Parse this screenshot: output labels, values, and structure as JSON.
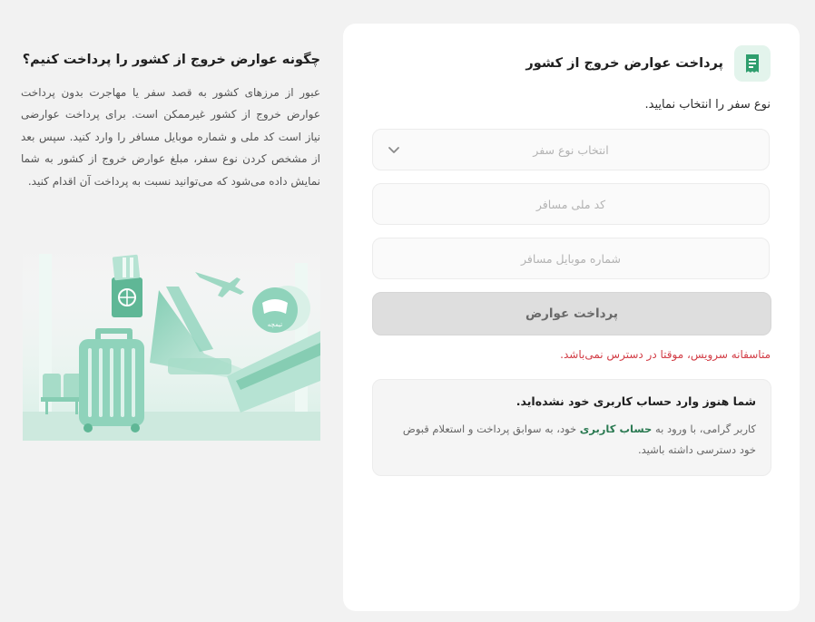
{
  "form": {
    "title": "پرداخت عوارض خروج از کشور",
    "icon": "receipt-icon",
    "accent_color": "#2f9e6e",
    "trip_type_label": "نوع سفر را انتخاب نمایید.",
    "trip_type_placeholder": "انتخاب نوع سفر",
    "national_id_placeholder": "کد ملی مسافر",
    "mobile_placeholder": "شماره موبایل مسافر",
    "pay_button": "پرداخت عوارض",
    "error_message": "متاسفانه سرویس، موقتا در دسترس نمی‌باشد."
  },
  "login_notice": {
    "title": "شما هنوز وارد حساب کاربری خود نشده‌اید.",
    "text_before": "کاربر گرامی، با ورود به",
    "link": "حساب کاربری",
    "text_after": "خود، به سوابق پرداخت و استعلام قبوض خود دسترسی داشته باشید."
  },
  "info": {
    "title": "چگونه عوارض خروج از کشور را پرداخت کنیم؟",
    "body": "عبور از مرزهای کشور به قصد سفر یا مهاجرت بدون پرداخت عوارض خروج از کشور غیرممکن است. برای پرداخت عوارضی نیاز است کد ملی و شماره موبایل مسافر را وارد کنید. سپس بعد از مشخص کردن نوع سفر، مبلغ عوارض خروج از کشور به شما نمایش داده می‌شود که می‌توانید نسبت به پرداخت آن اقدام کنید.",
    "badge_text": "تیمچه"
  }
}
